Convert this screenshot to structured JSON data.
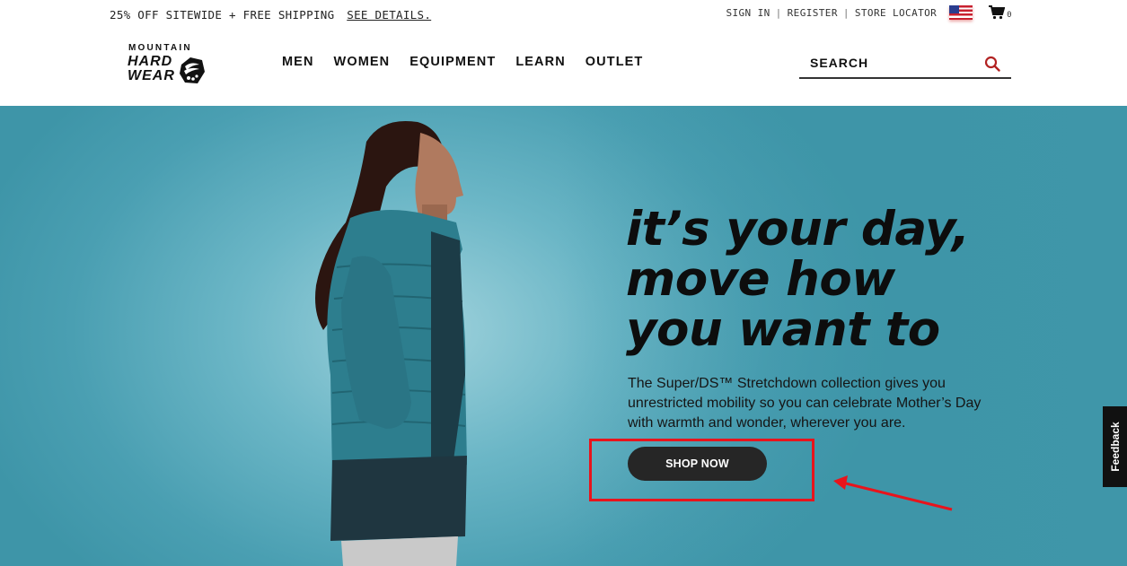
{
  "promo": {
    "text": "25% OFF SITEWIDE + FREE SHIPPING",
    "link": "SEE DETAILS."
  },
  "utility": {
    "sign_in": "SIGN IN",
    "separator": "|",
    "register": "REGISTER",
    "store_locator": "STORE LOCATOR",
    "cart_count": "0",
    "flag_icon": "us-flag-icon",
    "cart_icon": "cart-icon"
  },
  "logo": {
    "line1": "MOUNTAIN",
    "line2": "HARD",
    "line3": "WEAR"
  },
  "nav": {
    "items": [
      "MEN",
      "WOMEN",
      "EQUIPMENT",
      "LEARN",
      "OUTLET"
    ]
  },
  "search": {
    "placeholder": "SEARCH",
    "icon": "search-icon"
  },
  "hero": {
    "headline": [
      "it’s your day,",
      "move how",
      "you want to"
    ],
    "description": "The Super/DS™ Stretchdown collection gives you unrestricted mobility so you can celebrate Mother’s Day with warmth and wonder, wherever you are.",
    "cta": "SHOP NOW"
  },
  "feedback": {
    "label": "Feedback"
  },
  "colors": {
    "hero_bg": "#4a9fb2",
    "cta_bg": "#262626",
    "annotation": "#e8141c",
    "search_icon": "#b22222"
  }
}
